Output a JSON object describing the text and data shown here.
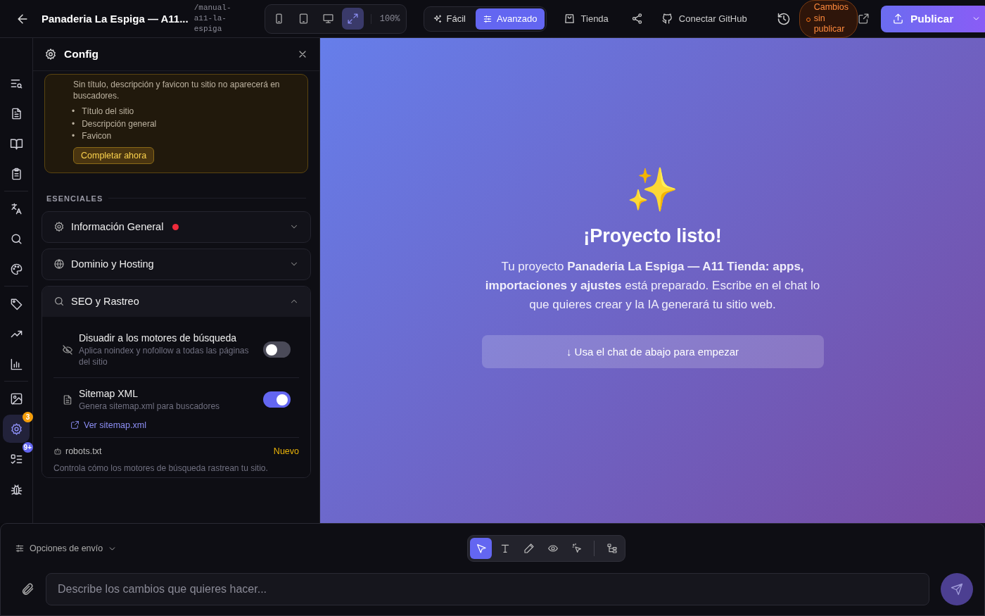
{
  "header": {
    "project_title": "Panaderia La Espiga — A11...",
    "slug": "/manual-a11-la-espiga",
    "devices": [
      {
        "kind": "phone",
        "selected": false
      },
      {
        "kind": "tablet",
        "selected": false
      },
      {
        "kind": "desktop",
        "selected": false
      },
      {
        "kind": "fullscreen",
        "selected": true
      }
    ],
    "zoom": "100%",
    "modes": [
      {
        "kind": "sparkle",
        "label": "Fácil",
        "selected": false
      },
      {
        "kind": "sliders",
        "label": "Avanzado",
        "selected": true
      }
    ],
    "actions": [
      {
        "kind": "bag",
        "label": "Tienda"
      },
      {
        "kind": "share"
      },
      {
        "kind": "github",
        "label": "Conectar GitHub"
      }
    ],
    "status": "Cambios sin publicar",
    "publish": "Publicar"
  },
  "rail": {
    "groups": [
      {
        "items": [
          {
            "kind": "list-search",
            "selected": false
          },
          {
            "kind": "file",
            "selected": false
          },
          {
            "kind": "book",
            "selected": false
          },
          {
            "kind": "clipboard",
            "selected": false
          }
        ]
      },
      {
        "items": [
          {
            "kind": "languages",
            "selected": false
          },
          {
            "kind": "search",
            "selected": false
          },
          {
            "kind": "palette",
            "selected": false
          }
        ]
      },
      {
        "items": [
          {
            "kind": "tag",
            "selected": false
          },
          {
            "kind": "trend",
            "selected": false
          },
          {
            "kind": "chart",
            "selected": false
          }
        ]
      },
      {
        "items": [
          {
            "kind": "image",
            "selected": false
          },
          {
            "kind": "gear",
            "selected": true,
            "badge": {
              "text": "3",
              "color": "#f59e0b"
            }
          },
          {
            "kind": "checklist",
            "selected": false,
            "badge": {
              "text": "9+",
              "color": "#6366f1"
            }
          },
          {
            "kind": "bug",
            "selected": false
          }
        ]
      }
    ]
  },
  "panel": {
    "title": "Config",
    "warning": {
      "text": "Sin título, descripción y favicon tu sitio no aparecerá en buscadores.",
      "items": [
        {
          "bullet": "•",
          "text": "Título del sitio"
        },
        {
          "bullet": "•",
          "text": "Descripción general"
        },
        {
          "bullet": "•",
          "text": "Favicon"
        }
      ],
      "button": "Completar ahora"
    },
    "section_label": "ESENCIALES",
    "accordions": [
      {
        "kind": "gear",
        "label": "Información General",
        "alert": true,
        "expanded": false
      },
      {
        "kind": "globe",
        "label": "Dominio y Hosting",
        "alert": false,
        "expanded": false
      },
      {
        "kind": "search",
        "label": "SEO y Rastreo",
        "alert": false,
        "expanded": true,
        "settings": [
          {
            "kind": "eye-off",
            "title": "Disuadir a los motores de búsqueda",
            "description": "Aplica noindex y nofollow a todas las páginas del sitio",
            "on": false
          },
          {
            "kind": "file",
            "title": "Sitemap XML",
            "description": "Genera sitemap.xml para buscadores",
            "on": true,
            "link": "Ver sitemap.xml"
          }
        ],
        "robots": {
          "label": "robots.txt",
          "badge": "Nuevo",
          "description": "Controla cómo los motores de búsqueda rastrean tu sitio."
        }
      }
    ]
  },
  "preview": {
    "emoji": "✨",
    "title": "¡Proyecto listo!",
    "text": "Tu proyecto **Panaderia La Espiga — A11 Tienda: apps, importaciones y ajustes** está preparado. Escribe en el chat lo que quieres crear y la IA generará tu sitio web.",
    "hint": "↓ Usa el chat de abajo para empezar"
  },
  "composer": {
    "options": "Opciones de envío",
    "tools": [
      {
        "kind": "pointer",
        "selected": true
      },
      {
        "kind": "text",
        "selected": false
      },
      {
        "kind": "pencil",
        "selected": false
      },
      {
        "kind": "eye",
        "selected": false
      },
      {
        "kind": "magic-pointer",
        "selected": false
      },
      {
        "kind": "tree",
        "selected": false
      }
    ],
    "placeholder": "Describe los cambios que quieres hacer..."
  }
}
